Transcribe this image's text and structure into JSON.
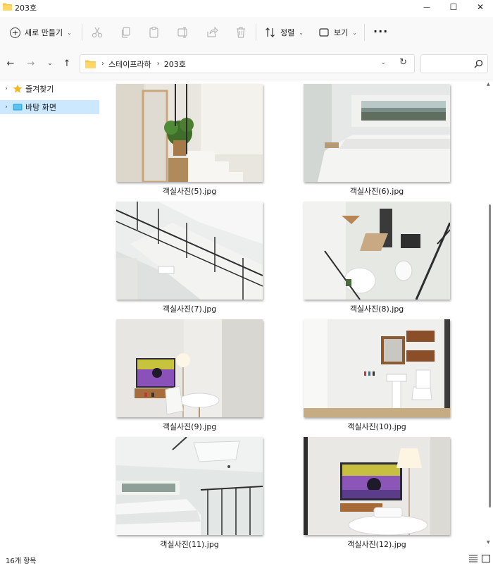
{
  "window": {
    "title": "203호",
    "minimize_glyph": "—",
    "maximize_glyph": "☐",
    "close_glyph": "✕"
  },
  "toolbar": {
    "new_label": "새로 만들기",
    "sort_label": "정렬",
    "view_label": "보기",
    "more_label": "···",
    "icons": [
      "cut-icon",
      "copy-icon",
      "paste-icon",
      "rename-icon",
      "share-icon",
      "delete-icon"
    ]
  },
  "navigation": {
    "breadcrumb": [
      "스테이프라하",
      "203호"
    ],
    "search_placeholder": ""
  },
  "sidebar": {
    "items": [
      {
        "label": "즐겨찾기",
        "icon": "star-icon",
        "selected": false
      },
      {
        "label": "바탕 화면",
        "icon": "desktop-icon",
        "selected": true
      }
    ]
  },
  "files": [
    {
      "name": "객실사진(5).jpg",
      "scene": "stairs-plant"
    },
    {
      "name": "객실사진(6).jpg",
      "scene": "bed-window"
    },
    {
      "name": "객실사진(7).jpg",
      "scene": "stair-railing"
    },
    {
      "name": "객실사진(8).jpg",
      "scene": "top-view"
    },
    {
      "name": "객실사진(9).jpg",
      "scene": "tv-table"
    },
    {
      "name": "객실사진(10).jpg",
      "scene": "bathroom"
    },
    {
      "name": "객실사진(11).jpg",
      "scene": "loft-bed"
    },
    {
      "name": "객실사진(12).jpg",
      "scene": "tv-lamp"
    }
  ],
  "status": {
    "item_count": "16개 항목"
  },
  "colors": {
    "selection": "#cce8ff",
    "folder": "#f5c84c",
    "accent": "#0067c0"
  }
}
